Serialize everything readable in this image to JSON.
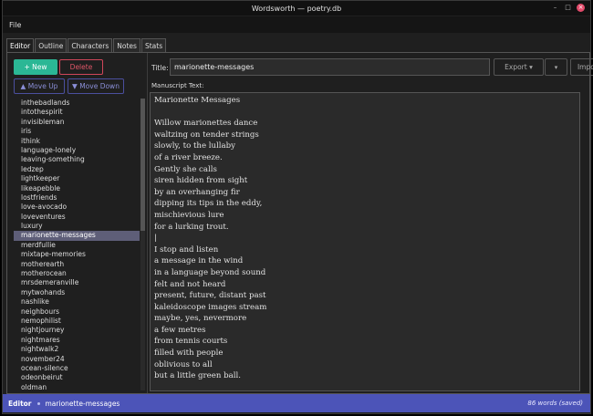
{
  "window": {
    "title": "Wordsworth — poetry.db"
  },
  "menu": {
    "file": "File"
  },
  "tabs": [
    "Editor",
    "Outline",
    "Characters",
    "Notes",
    "Stats"
  ],
  "sidebar": {
    "new_label": "+ New",
    "delete_label": "Delete",
    "move_up_label": "▲ Move Up",
    "move_down_label": "▼ Move Down",
    "items": [
      "inthebadlands",
      "intothespirit",
      "invisibleman",
      "iris",
      "ithink",
      "language-lonely",
      "leaving-something",
      "ledzep",
      "lightkeeper",
      "likeapebble",
      "lostfriends",
      "love-avocado",
      "loveventures",
      "luxury",
      "marionette-messages",
      "merdfullie",
      "mixtape-memories",
      "motherearth",
      "motherocean",
      "mrsdemeranville",
      "mytwohands",
      "nashlike",
      "neighbours",
      "nemophilist",
      "nightjourney",
      "nightmares",
      "nightwalk2",
      "november24",
      "ocean-silence",
      "odeonbeirut",
      "oldman"
    ],
    "selected": "marionette-messages"
  },
  "editor": {
    "title_label": "Title:",
    "title_value": "marionette-messages",
    "export_label": "Export ▾",
    "export_dropdown": "▾",
    "import_label": "Import...",
    "manuscript_label": "Manuscript Text:",
    "manuscript_text": "Marionette Messages\n\nWillow marionettes dance\nwaltzing on tender strings\nslowly, to the lullaby\nof a river breeze.\nGently she calls\nsiren hidden from sight\nby an overhanging fir\ndipping its tips in the eddy,\nmischievious lure\nfor a lurking trout.\n|\nI stop and listen\na message in the wind\nin a language beyond sound\nfelt and not heard\npresent, future, distant past\nkaleidoscope images stream\nmaybe, yes, nevermore\na few metres\nfrom tennis courts\nfilled with people\noblivious to all\nbut a little green ball."
  },
  "status": {
    "mode": "Editor",
    "document": "marionette-messages",
    "word_count": "86 words (saved)"
  }
}
